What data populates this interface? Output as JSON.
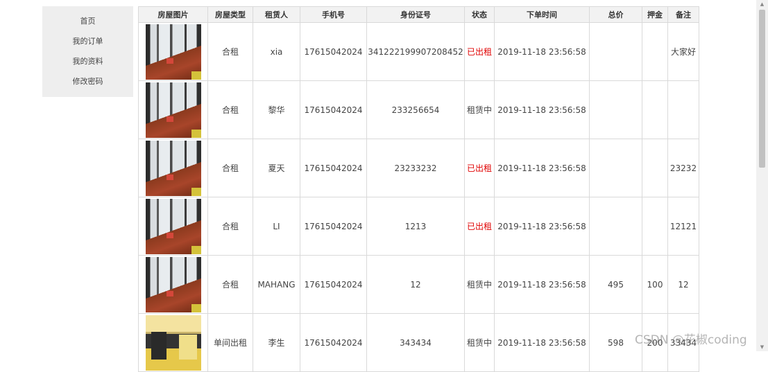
{
  "sidebar": {
    "items": [
      {
        "label": "首页"
      },
      {
        "label": "我的订单"
      },
      {
        "label": "我的资料"
      },
      {
        "label": "修改密码"
      }
    ]
  },
  "table": {
    "headers": [
      "房屋图片",
      "房屋类型",
      "租赁人",
      "手机号",
      "身份证号",
      "状态",
      "下单时间",
      "总价",
      "押金",
      "备注"
    ],
    "rows": [
      {
        "image": "balcony",
        "type": "合租",
        "tenant": "xia",
        "phone": "17615042024",
        "id_number": "341222199907208452",
        "status": "已出租",
        "status_color": "#e00000",
        "time": "2019-11-18 23:56:58",
        "total": "",
        "deposit": "",
        "note": "大家好"
      },
      {
        "image": "balcony",
        "type": "合租",
        "tenant": "黎华",
        "phone": "17615042024",
        "id_number": "233256654",
        "status": "租赁中",
        "status_color": "#444444",
        "time": "2019-11-18 23:56:58",
        "total": "",
        "deposit": "",
        "note": ""
      },
      {
        "image": "balcony",
        "type": "合租",
        "tenant": "夏天",
        "phone": "17615042024",
        "id_number": "23233232",
        "status": "已出租",
        "status_color": "#e00000",
        "time": "2019-11-18 23:56:58",
        "total": "",
        "deposit": "",
        "note": "23232"
      },
      {
        "image": "balcony",
        "type": "合租",
        "tenant": "LI",
        "phone": "17615042024",
        "id_number": "1213",
        "status": "已出租",
        "status_color": "#e00000",
        "time": "2019-11-18 23:56:58",
        "total": "",
        "deposit": "",
        "note": "12121"
      },
      {
        "image": "balcony",
        "type": "合租",
        "tenant": "MAHANG",
        "phone": "17615042024",
        "id_number": "12",
        "status": "租赁中",
        "status_color": "#444444",
        "time": "2019-11-18 23:56:58",
        "total": "495",
        "deposit": "100",
        "note": "12"
      },
      {
        "image": "room",
        "type": "单间出租",
        "tenant": "李生",
        "phone": "17615042024",
        "id_number": "343434",
        "status": "租赁中",
        "status_color": "#444444",
        "time": "2019-11-18 23:56:58",
        "total": "598",
        "deposit": "200",
        "note": "33434"
      }
    ]
  },
  "watermark": "CSDN @花椒coding"
}
